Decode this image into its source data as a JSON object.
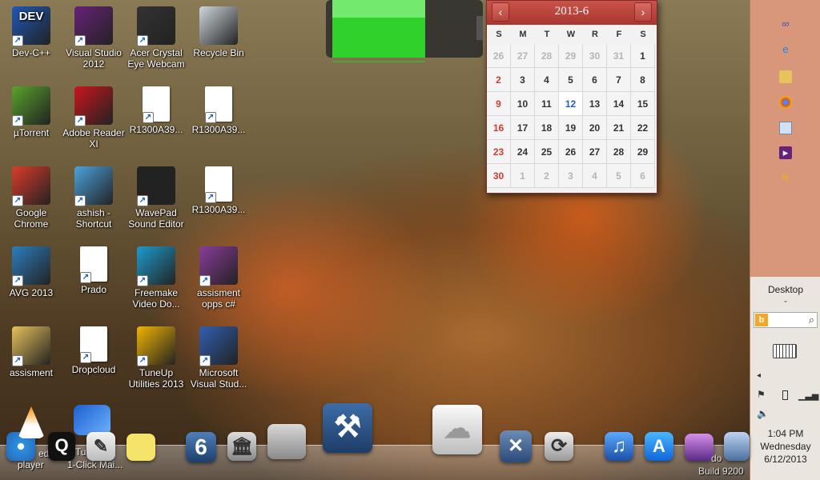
{
  "desktop_icons": [
    {
      "label": "Dev-C++",
      "badge": "DEV",
      "color": "#1d58b8"
    },
    {
      "label": "Visual Studio 2012",
      "color": "#68217a"
    },
    {
      "label": "Acer Crystal Eye Webcam",
      "color": "#333333"
    },
    {
      "label": "Recycle Bin",
      "color": "#cfd8df"
    },
    {
      "label": "µTorrent",
      "color": "#59a32a"
    },
    {
      "label": "Adobe Reader XI",
      "color": "#c8161c"
    },
    {
      "label": "R1300A39...",
      "color": "#ffffff"
    },
    {
      "label": "R1300A39...",
      "color": "#ffffff"
    },
    {
      "label": "Google Chrome",
      "color": "#dd3b2b"
    },
    {
      "label": "ashish - Shortcut",
      "color": "#4aa3df"
    },
    {
      "label": "WavePad Sound Editor",
      "color": "#222222"
    },
    {
      "label": "R1300A39...",
      "color": "#ffffff"
    },
    {
      "label": "AVG 2013",
      "color": "#2b7fc1"
    },
    {
      "label": "Prado",
      "color": "#ffffff"
    },
    {
      "label": "Freemake Video Do...",
      "color": "#1b9ccf"
    },
    {
      "label": "assisment opps c#",
      "color": "#8b3b9b"
    },
    {
      "label": "assisment",
      "color": "#e8c25a"
    },
    {
      "label": "Dropcloud",
      "color": "#ffffff"
    },
    {
      "label": "TuneUp Utilities 2013",
      "color": "#f2b400"
    },
    {
      "label": "Microsoft Visual Stud...",
      "color": "#2f5fb3"
    }
  ],
  "calendar": {
    "month_label": "2013-6",
    "prev": "‹",
    "next": "›",
    "weekdays": [
      "S",
      "M",
      "T",
      "W",
      "R",
      "F",
      "S"
    ],
    "days": [
      {
        "n": "26",
        "o": true
      },
      {
        "n": "27",
        "o": true
      },
      {
        "n": "28",
        "o": true
      },
      {
        "n": "29",
        "o": true
      },
      {
        "n": "30",
        "o": true
      },
      {
        "n": "31",
        "o": true
      },
      {
        "n": "1"
      },
      {
        "n": "2"
      },
      {
        "n": "3"
      },
      {
        "n": "4"
      },
      {
        "n": "5"
      },
      {
        "n": "6"
      },
      {
        "n": "7"
      },
      {
        "n": "8"
      },
      {
        "n": "9"
      },
      {
        "n": "10"
      },
      {
        "n": "11"
      },
      {
        "n": "12",
        "today": true
      },
      {
        "n": "13"
      },
      {
        "n": "14"
      },
      {
        "n": "15"
      },
      {
        "n": "16"
      },
      {
        "n": "17"
      },
      {
        "n": "18"
      },
      {
        "n": "19"
      },
      {
        "n": "20"
      },
      {
        "n": "21"
      },
      {
        "n": "22"
      },
      {
        "n": "23"
      },
      {
        "n": "24"
      },
      {
        "n": "25"
      },
      {
        "n": "26"
      },
      {
        "n": "27"
      },
      {
        "n": "28"
      },
      {
        "n": "29"
      },
      {
        "n": "30"
      },
      {
        "n": "1",
        "o": true
      },
      {
        "n": "2",
        "o": true
      },
      {
        "n": "3",
        "o": true
      },
      {
        "n": "4",
        "o": true
      },
      {
        "n": "5",
        "o": true
      },
      {
        "n": "6",
        "o": true
      }
    ]
  },
  "panel": {
    "desktop_label": "Desktop",
    "search_placeholder": "",
    "time": "1:04 PM",
    "weekday": "Wednesday",
    "date": "6/12/2013",
    "icons": [
      "infinity-icon",
      "ie-icon",
      "explorer-icon",
      "chrome-icon",
      "notepad-icon",
      "visual-studio-icon",
      "paint-icon"
    ]
  },
  "dock": {
    "left_labels": [
      "ed",
      "player",
      "Tu",
      "1-Click Mai..."
    ],
    "right_labels": [
      "do",
      "Build 9200"
    ]
  }
}
